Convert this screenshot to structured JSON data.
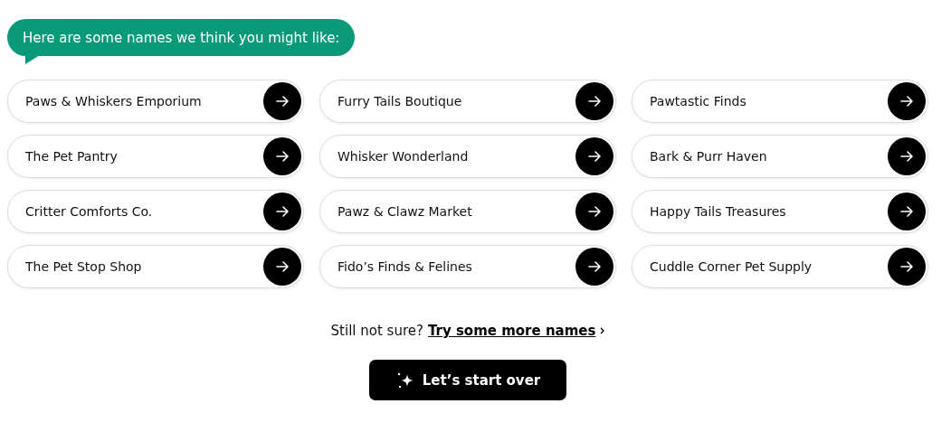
{
  "bubble": {
    "text": "Here are some names we think you might like:"
  },
  "names": [
    {
      "label": "Paws & Whiskers Emporium"
    },
    {
      "label": "Furry Tails Boutique"
    },
    {
      "label": "Pawtastic Finds"
    },
    {
      "label": "The Pet Pantry"
    },
    {
      "label": "Whisker Wonderland"
    },
    {
      "label": "Bark & Purr Haven"
    },
    {
      "label": "Critter Comforts Co."
    },
    {
      "label": "Pawz & Clawz Market"
    },
    {
      "label": "Happy Tails Treasures"
    },
    {
      "label": "The Pet Stop Shop"
    },
    {
      "label": "Fido’s Finds & Felines"
    },
    {
      "label": "Cuddle Corner Pet Supply"
    }
  ],
  "more": {
    "prompt": "Still not sure?",
    "link": "Try some more names"
  },
  "restart_button": "Let’s start over"
}
